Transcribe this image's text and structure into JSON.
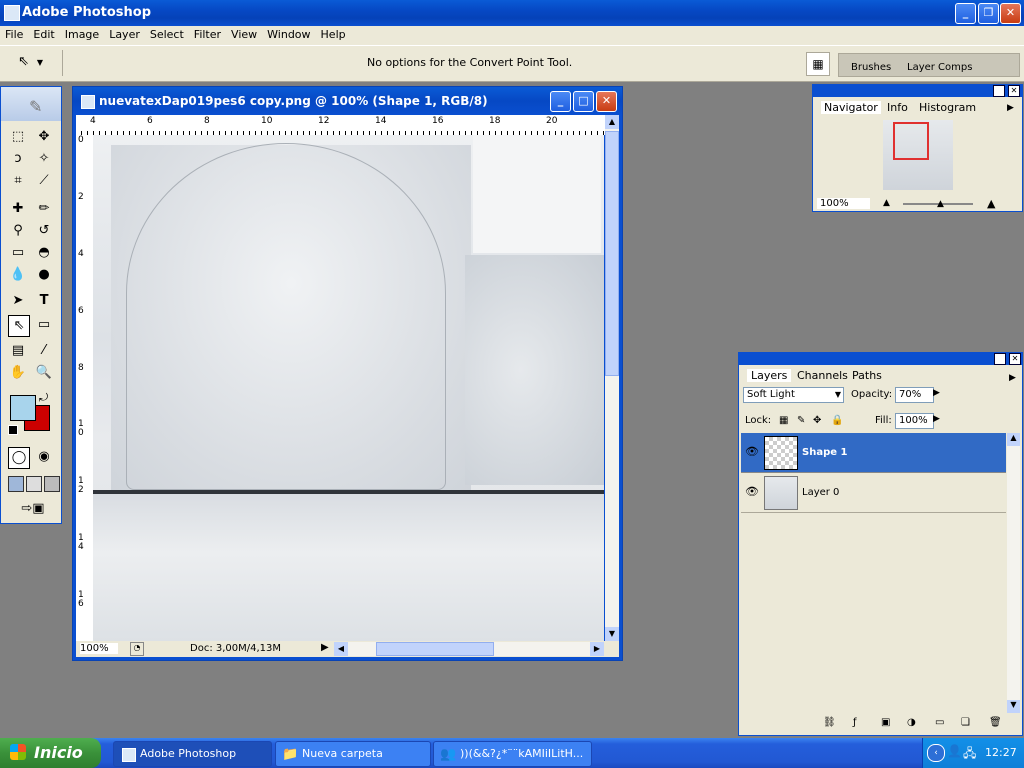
{
  "app": {
    "title": "Adobe Photoshop"
  },
  "menu": [
    "File",
    "Edit",
    "Image",
    "Layer",
    "Select",
    "Filter",
    "View",
    "Window",
    "Help"
  ],
  "options_bar": {
    "message": "No options for the Convert Point Tool.",
    "dock_tabs": [
      "Brushes",
      "Layer Comps"
    ]
  },
  "document": {
    "title": "nuevatexDap019pes6 copy.png @ 100% (Shape 1, RGB/8)",
    "zoom": "100%",
    "doc_info": "Doc: 3,00M/4,13M",
    "ruler_top": [
      "4",
      "6",
      "8",
      "10",
      "12",
      "14",
      "16",
      "18",
      "20"
    ],
    "ruler_left": [
      "0",
      "2",
      "4",
      "6",
      "8",
      "1 0",
      "1 2",
      "1 4",
      "1 6"
    ]
  },
  "navigator": {
    "tabs": [
      "Navigator",
      "Info",
      "Histogram"
    ],
    "zoom": "100%"
  },
  "layers": {
    "tabs": [
      "Layers",
      "Channels",
      "Paths"
    ],
    "blend_mode": "Soft Light",
    "opacity_label": "Opacity:",
    "opacity": "70%",
    "lock_label": "Lock:",
    "fill_label": "Fill:",
    "fill": "100%",
    "items": [
      {
        "name": "Shape 1",
        "selected": true
      },
      {
        "name": "Layer 0",
        "selected": false
      }
    ]
  },
  "colors": {
    "foreground": "#a8d4ec",
    "background": "#cc0000",
    "selection": "#316ac5"
  },
  "taskbar": {
    "start_label": "Inicio",
    "tasks": [
      "Adobe Photoshop",
      "Nueva carpeta",
      "))(&&?¿*¨¨kAMIiILitH..."
    ],
    "clock": "12:27"
  }
}
